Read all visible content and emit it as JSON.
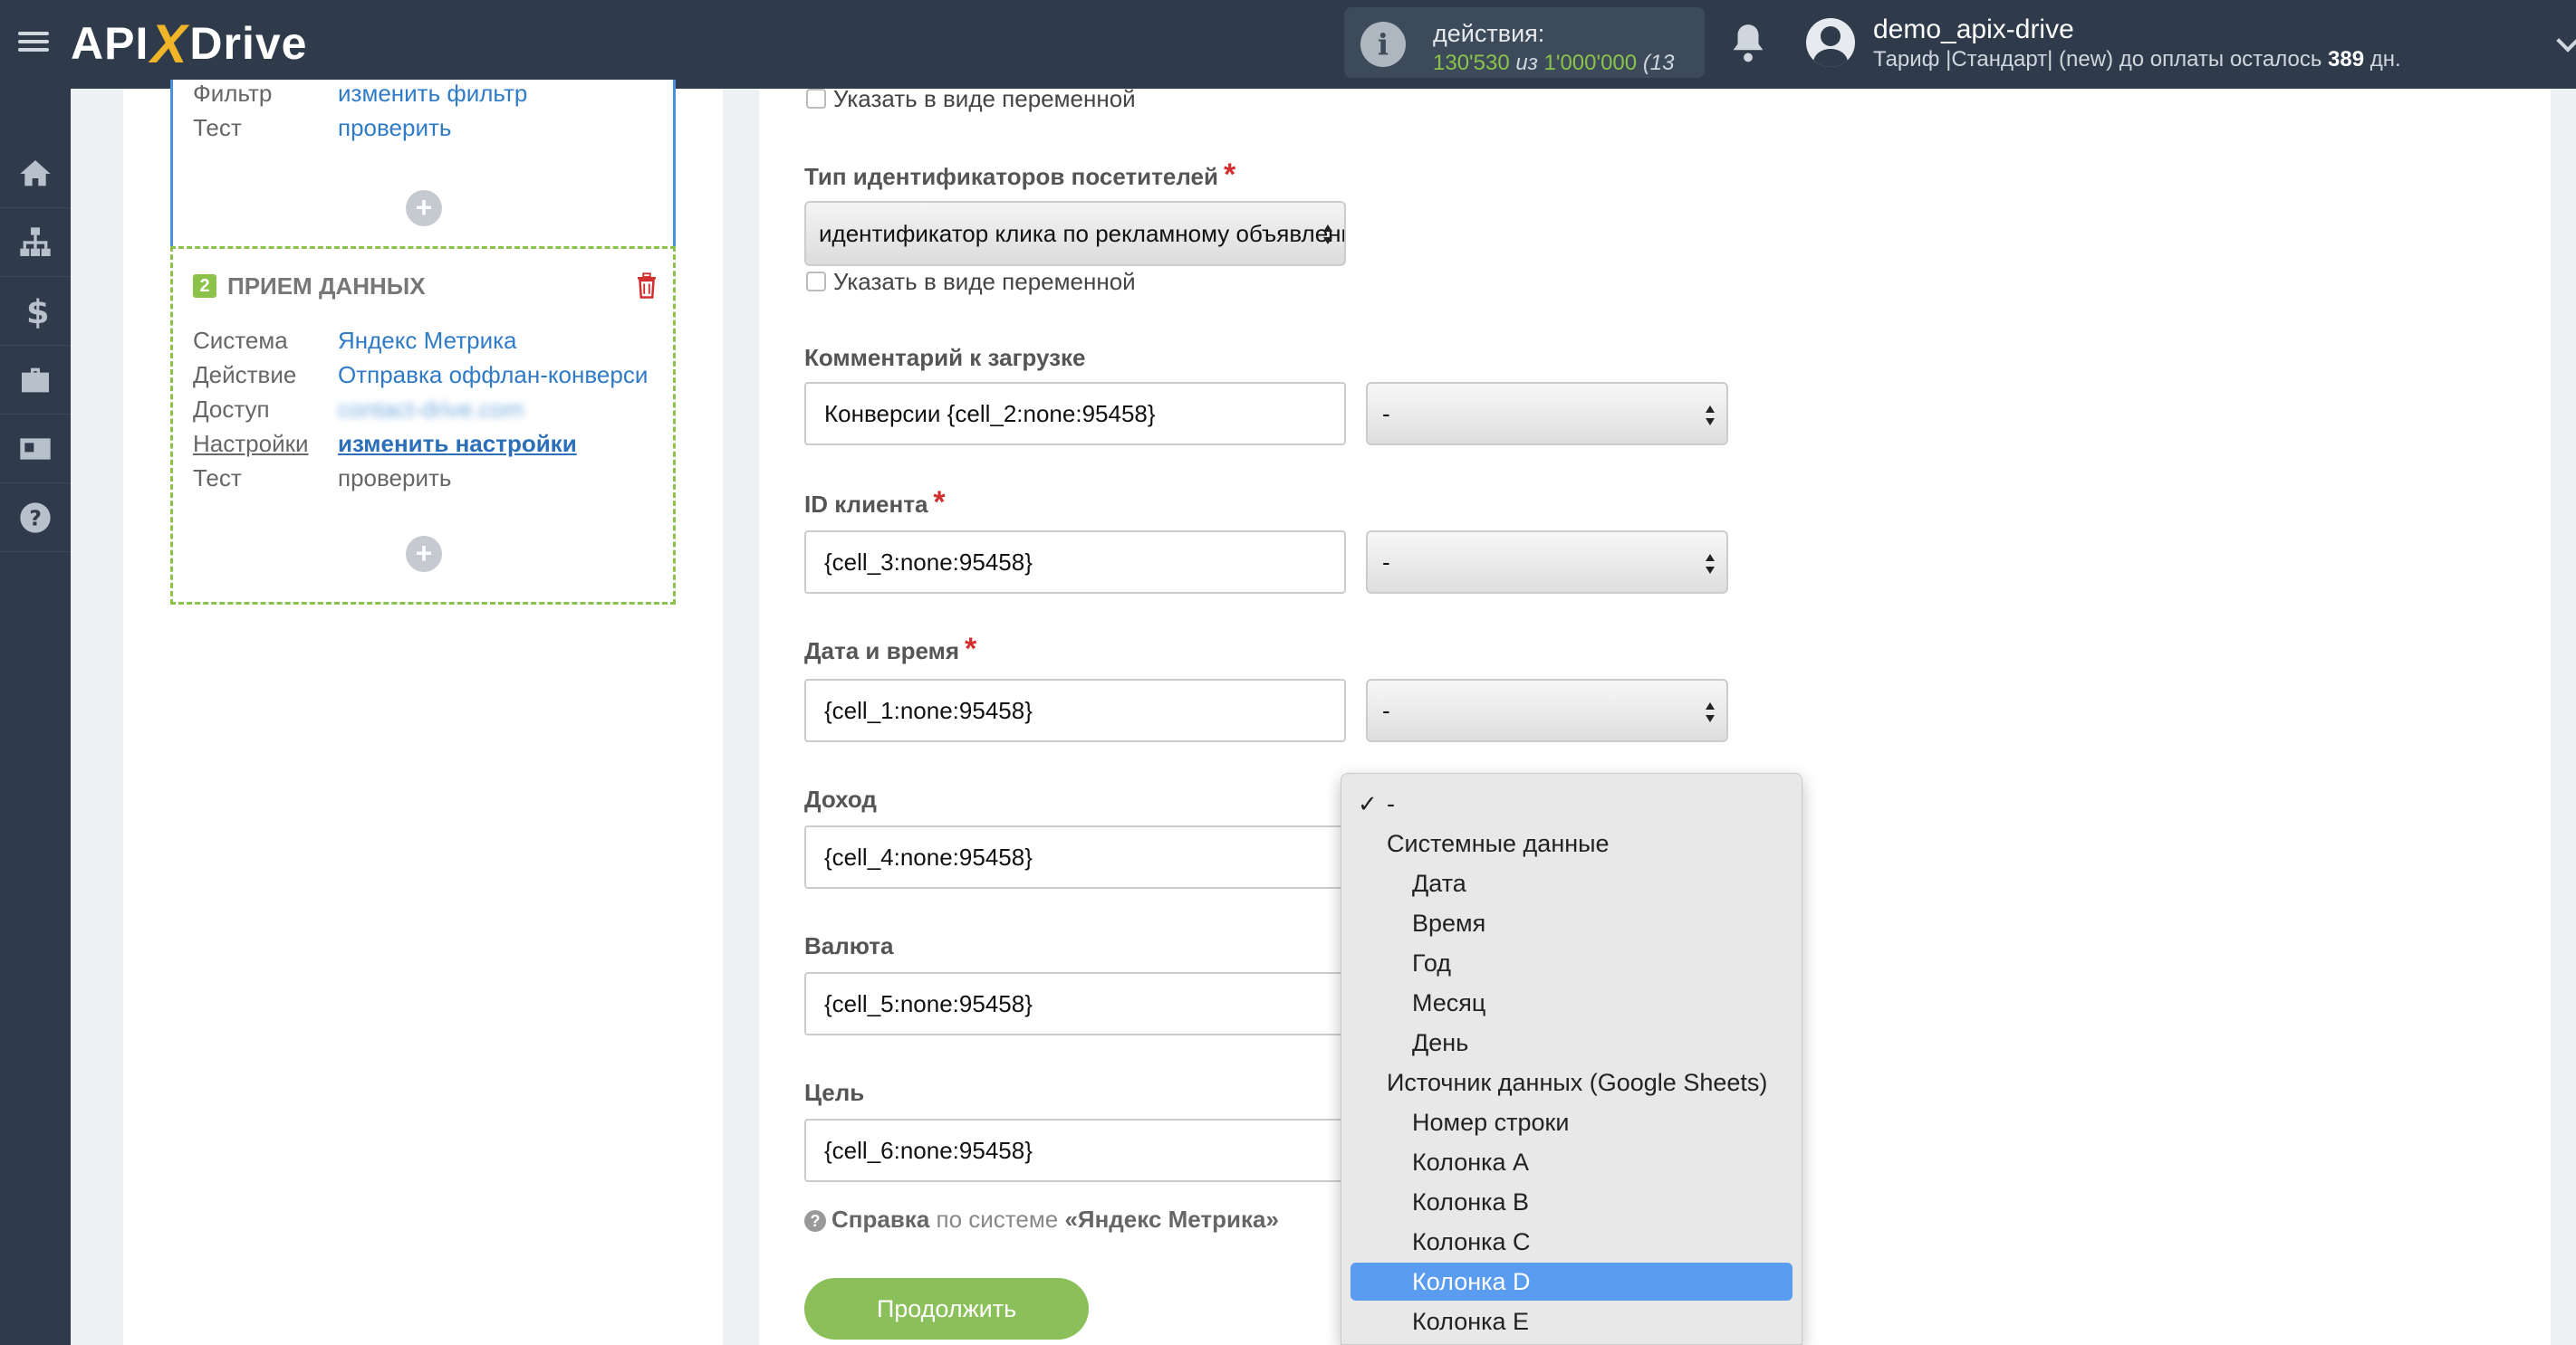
{
  "app": {
    "logo_prefix": "API",
    "logo_x": "X",
    "logo_suffix": "Drive"
  },
  "topbar": {
    "actions_label": "действия:",
    "actions_used": "130'530",
    "actions_of": "из",
    "actions_limit": "1'000'000",
    "actions_rest": "(13",
    "username": "demo_apix-drive",
    "tariff_prefix": "Тариф |Стандарт| (new) до оплаты осталось",
    "tariff_days": "389",
    "tariff_suffix": "дн."
  },
  "sidebar": {
    "icons": [
      "home-icon",
      "sitemap-icon",
      "dollar-icon",
      "briefcase-icon",
      "id-card-icon",
      "help-icon"
    ]
  },
  "left": {
    "card1": {
      "filter_key": "Фильтр",
      "filter_value": "изменить фильтр",
      "test_key": "Тест",
      "test_value": "проверить"
    },
    "card2": {
      "badge": "2",
      "title": "ПРИЕМ ДАННЫХ",
      "rows": [
        {
          "key": "Система",
          "value": "Яндекс Метрика"
        },
        {
          "key": "Действие",
          "value": "Отправка оффлан-конверси"
        },
        {
          "key": "Доступ",
          "value": "contact-drive.com"
        },
        {
          "key": "Настройки",
          "value": "изменить настройки"
        },
        {
          "key": "Тест",
          "value": "проверить"
        }
      ]
    },
    "plus": "+"
  },
  "form": {
    "as_variable": "Указать в виде переменной",
    "visitor_id_label": "Тип идентификаторов посетителей",
    "visitor_id_value": "идентификатор клика по рекламному объявлению",
    "comment_label": "Комментарий к загрузке",
    "comment_value": "Конверсии {cell_2:none:95458}",
    "client_id_label": "ID клиента",
    "client_id_value": "{cell_3:none:95458}",
    "datetime_label": "Дата и время",
    "datetime_value": "{cell_1:none:95458}",
    "revenue_label": "Доход",
    "revenue_value": "{cell_4:none:95458}",
    "currency_label": "Валюта",
    "currency_value": "{cell_5:none:95458}",
    "goal_label": "Цель",
    "goal_value": "{cell_6:none:95458}",
    "select_default": "-",
    "required_mark": "*",
    "help_bold": "Справка",
    "help_mid": "по системе",
    "help_system": "«Яндекс Метрика»",
    "continue": "Продолжить"
  },
  "dropdown": {
    "checkmark": "✓",
    "options": [
      {
        "label": "-",
        "kind": "item-top",
        "checked": true
      },
      {
        "label": "Системные данные",
        "kind": "group"
      },
      {
        "label": "Дата",
        "kind": "item"
      },
      {
        "label": "Время",
        "kind": "item"
      },
      {
        "label": "Год",
        "kind": "item"
      },
      {
        "label": "Месяц",
        "kind": "item"
      },
      {
        "label": "День",
        "kind": "item"
      },
      {
        "label": "Источник данных (Google Sheets)",
        "kind": "group"
      },
      {
        "label": "Номер строки",
        "kind": "item"
      },
      {
        "label": "Колонка A",
        "kind": "item"
      },
      {
        "label": "Колонка B",
        "kind": "item"
      },
      {
        "label": "Колонка C",
        "kind": "item"
      },
      {
        "label": "Колонка D",
        "kind": "item",
        "selected": true
      },
      {
        "label": "Колонка E",
        "kind": "item"
      }
    ]
  },
  "colors": {
    "topbar": "#2f3b4a",
    "accent_blue": "#4a90e2",
    "accent_green": "#8bc34a",
    "selected_option": "#5a9cf0",
    "required": "#d32f2f"
  }
}
